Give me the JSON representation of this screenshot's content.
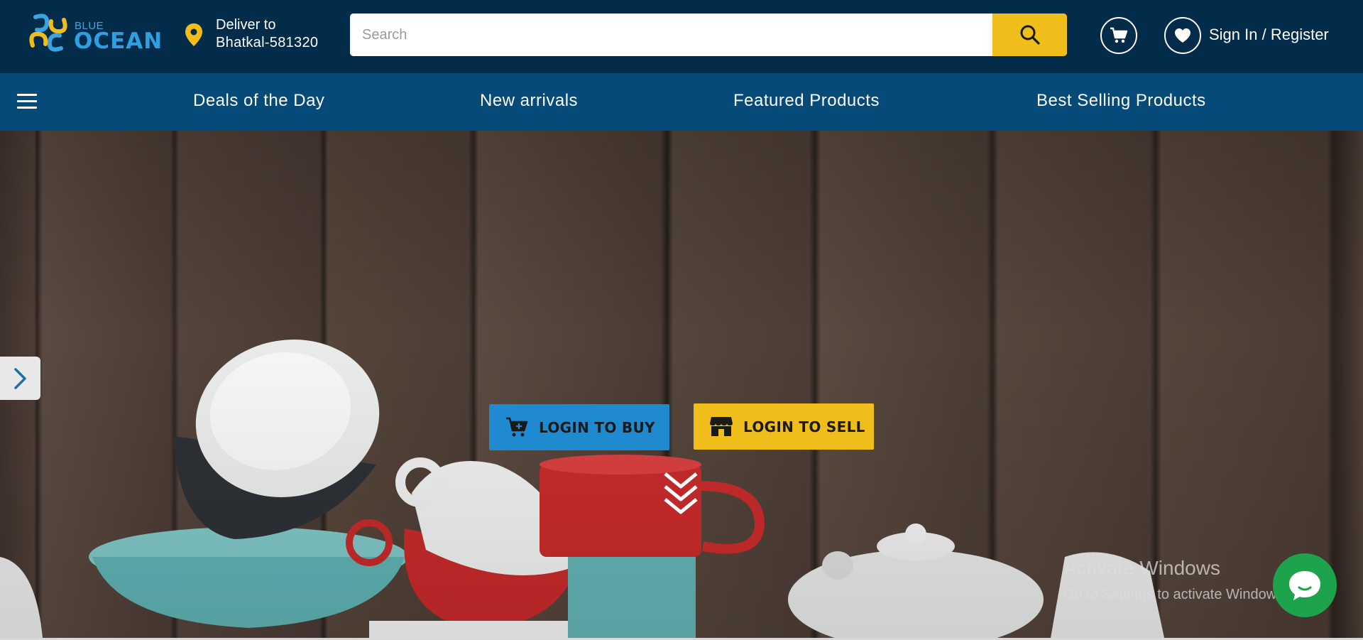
{
  "header": {
    "logo": {
      "small": "BLUE",
      "big": "OCEAN"
    },
    "deliver": {
      "line1": "Deliver to",
      "line2": "Bhatkal-581320"
    },
    "search": {
      "placeholder": "Search"
    },
    "signin_label": "Sign In / Register"
  },
  "nav": {
    "items": [
      {
        "label": "Deals of the Day"
      },
      {
        "label": "New arrivals"
      },
      {
        "label": "Featured Products"
      },
      {
        "label": "Best Selling Products"
      }
    ]
  },
  "hero": {
    "login_buy": "LOGIN TO BUY",
    "login_sell": "LOGIN TO SELL"
  },
  "watermark": {
    "line1": "Activate Windows",
    "line2": "Go to Settings to activate Windows."
  },
  "colors": {
    "header_bg": "#032b4a",
    "nav_bg": "#054a78",
    "accent_yellow": "#f0be1b",
    "accent_blue": "#1f8ad0",
    "chat_green": "#1ea34d"
  }
}
